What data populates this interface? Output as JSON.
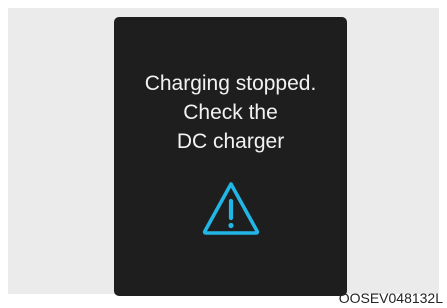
{
  "display": {
    "message_lines": [
      "Charging stopped.",
      "Check the",
      "DC charger"
    ],
    "icon": "warning-triangle-icon",
    "background_color": "#1e1e1e",
    "text_color": "#f2f2f2",
    "icon_color": "#22b6e6"
  },
  "figure": {
    "code": "OOSEV048132L",
    "background_color": "#ebebeb"
  }
}
